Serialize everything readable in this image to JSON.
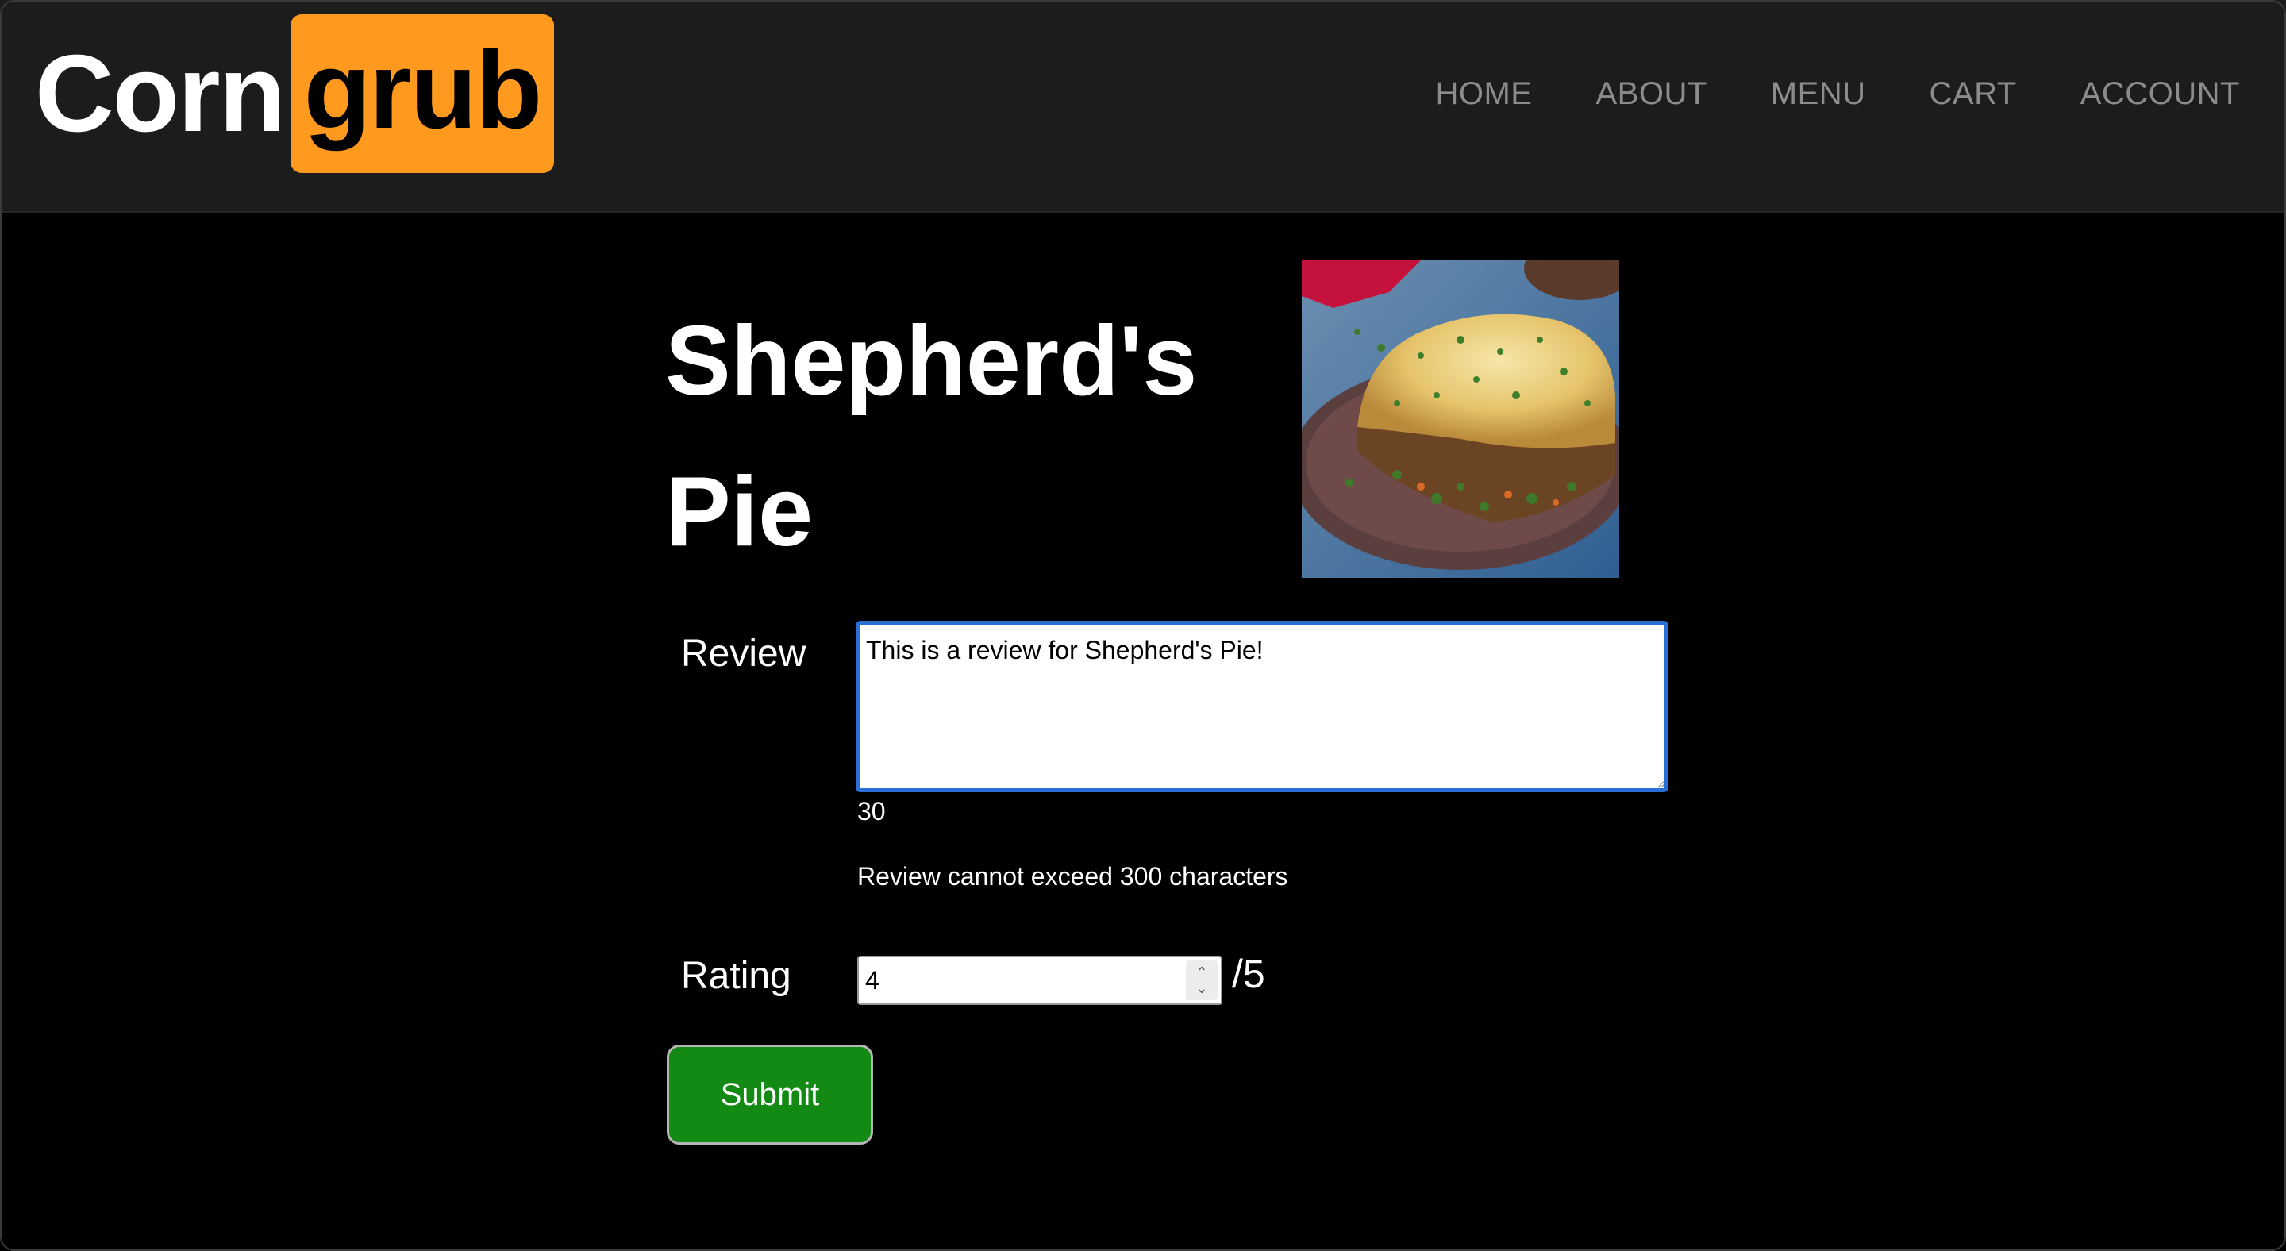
{
  "header": {
    "logo": {
      "part1": "Corn",
      "part2": "grub"
    },
    "nav": [
      "HOME",
      "ABOUT",
      "MENU",
      "CART",
      "ACCOUNT"
    ]
  },
  "main": {
    "title_line1": "Shepherd's",
    "title_line2": "Pie",
    "image_icon": "dish-photo",
    "review": {
      "label": "Review",
      "value": "This is a review for Shepherd's Pie!",
      "char_count": "30",
      "limit_text": "Review cannot exceed 300 characters"
    },
    "rating": {
      "label": "Rating",
      "value": "4",
      "out_of": "/5"
    },
    "submit_label": "Submit"
  },
  "colors": {
    "header_bg": "#1c1c1c",
    "logo_accent": "#ff9a1f",
    "submit_bg": "#138a13",
    "focus_border": "#2a6fd6"
  }
}
